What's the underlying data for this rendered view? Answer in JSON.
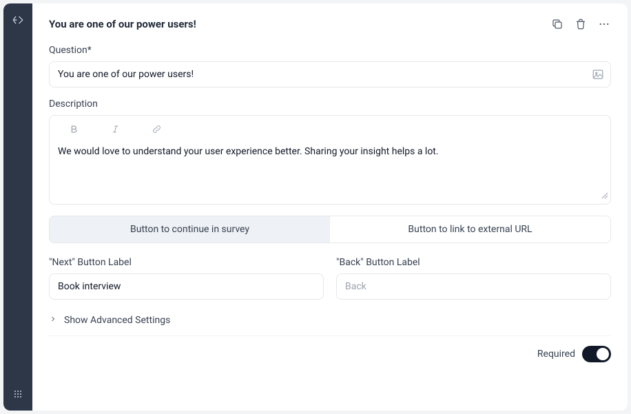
{
  "header": {
    "title": "You are one of our power users!"
  },
  "question": {
    "label": "Question*",
    "value": "You are one of our power users!"
  },
  "description": {
    "label": "Description",
    "value": "We would love to understand your user experience better. Sharing your insight helps a lot."
  },
  "buttonTypeSegments": {
    "continue": "Button to continue in survey",
    "external": "Button to link to external URL"
  },
  "nextButton": {
    "label": "\"Next\" Button Label",
    "value": "Book interview"
  },
  "backButton": {
    "label": "\"Back\" Button Label",
    "placeholder": "Back"
  },
  "advanced": {
    "label": "Show Advanced Settings"
  },
  "footer": {
    "requiredLabel": "Required"
  }
}
